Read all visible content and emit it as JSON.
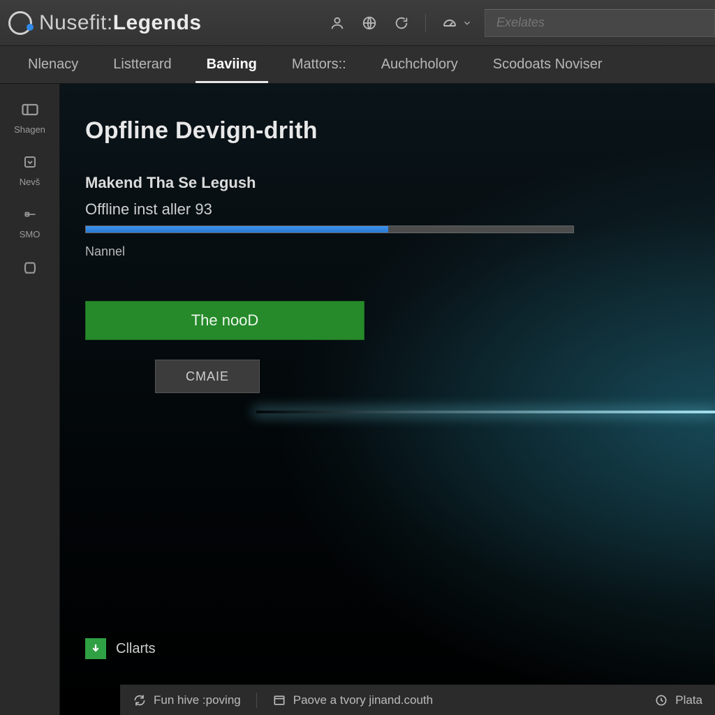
{
  "header": {
    "brand_prefix": "Nusefit",
    "brand_suffix": "Legends",
    "search_placeholder": "Exelates"
  },
  "tabs": [
    {
      "label": "Nlenacy",
      "active": false
    },
    {
      "label": "Listterard",
      "active": false
    },
    {
      "label": "Baviing",
      "active": true
    },
    {
      "label": "Mattors::",
      "active": false
    },
    {
      "label": "Auchcholory",
      "active": false
    },
    {
      "label": "Scodoats Noviser",
      "active": false
    }
  ],
  "sidebar": [
    {
      "icon": "panel-icon",
      "label": "Shagen"
    },
    {
      "icon": "chevbox-icon",
      "label": "Nevš"
    },
    {
      "icon": "slider-icon",
      "label": "SMO"
    },
    {
      "icon": "jar-icon",
      "label": ""
    }
  ],
  "main": {
    "page_title": "Opfline Devign-drith",
    "subtitle": "Makend Tha Se Legush",
    "progress_label": "Offline inst aller 93",
    "progress_percent": 62,
    "caption": "Nannel",
    "primary_button_label": "The nooD",
    "secondary_button_label": "CMAIE",
    "download_row_label": "Cllarts"
  },
  "footer": {
    "item1": "Fun hive :poving",
    "item2": "Paove a tvory jinand.couth",
    "item3": "Plata"
  },
  "colors": {
    "accent_blue": "#3089e6",
    "green": "#268a2a"
  }
}
